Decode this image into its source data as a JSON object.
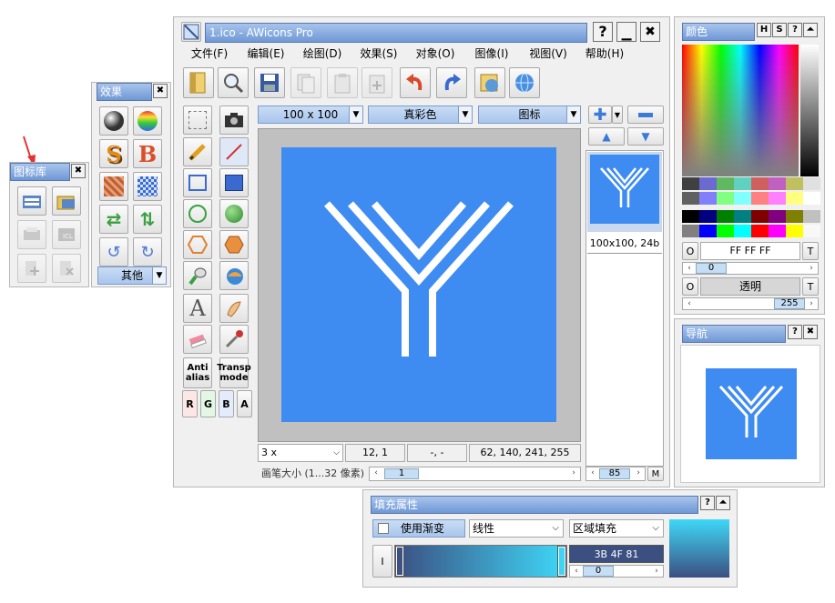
{
  "main_window": {
    "title": "1.ico - AWicons Pro",
    "controls": [
      "?",
      "—",
      "✖"
    ],
    "menu": [
      "文件(F)",
      "编辑(E)",
      "绘图(D)",
      "效果(S)",
      "对象(O)",
      "图像(I)",
      "视图(V)",
      "帮助(H)"
    ],
    "toolbar_icons": [
      "open-icon",
      "zoom-icon",
      "save-icon",
      "copy-icon",
      "paste-icon",
      "paste-new-icon",
      "undo-icon",
      "redo-icon",
      "export-icon",
      "web-icon"
    ],
    "size_select": "100 x 100",
    "color_select": "真彩色",
    "type_select": "图标",
    "zoom_select": "3 x",
    "cursor_pos": "12, 1",
    "selection_info": "-, -",
    "pixel_color": "62, 140, 241, 255",
    "pen_size_label": "画笔大小 (1...32 像素)",
    "pen_size_value": "1",
    "thumb_caption": "100x100, 24b",
    "thumb_scroll_value": "85",
    "thumb_m_label": "M",
    "antialias_label": "Anti alias",
    "transp_label": "Transp mode",
    "channels": [
      "R",
      "G",
      "B",
      "A"
    ]
  },
  "effects_panel": {
    "title": "效果",
    "other_label": "其他"
  },
  "library_panel": {
    "title": "图标库"
  },
  "color_panel": {
    "title": "颜色",
    "title_buttons": [
      "H",
      "S",
      "?",
      "⏶"
    ],
    "primary_label": "O",
    "primary_value": "FF FF FF",
    "primary_t": "T",
    "primary_alpha": "0",
    "secondary_label": "O",
    "secondary_value": "透明",
    "secondary_t": "T",
    "secondary_alpha": "255"
  },
  "nav_panel": {
    "title": "导航",
    "title_buttons": [
      "?",
      "✖"
    ]
  },
  "fill_panel": {
    "title": "填充属性",
    "title_buttons": [
      "?",
      "⏶"
    ],
    "use_gradient": "使用渐变",
    "gradient_type": "线性",
    "fill_mode": "区域填充",
    "i_label": "I",
    "stop_color": "3B 4F 81",
    "stop_value": "0"
  },
  "colors": {
    "icon_blue": "#3e8cf1",
    "title_blue": "#6f98d6"
  }
}
